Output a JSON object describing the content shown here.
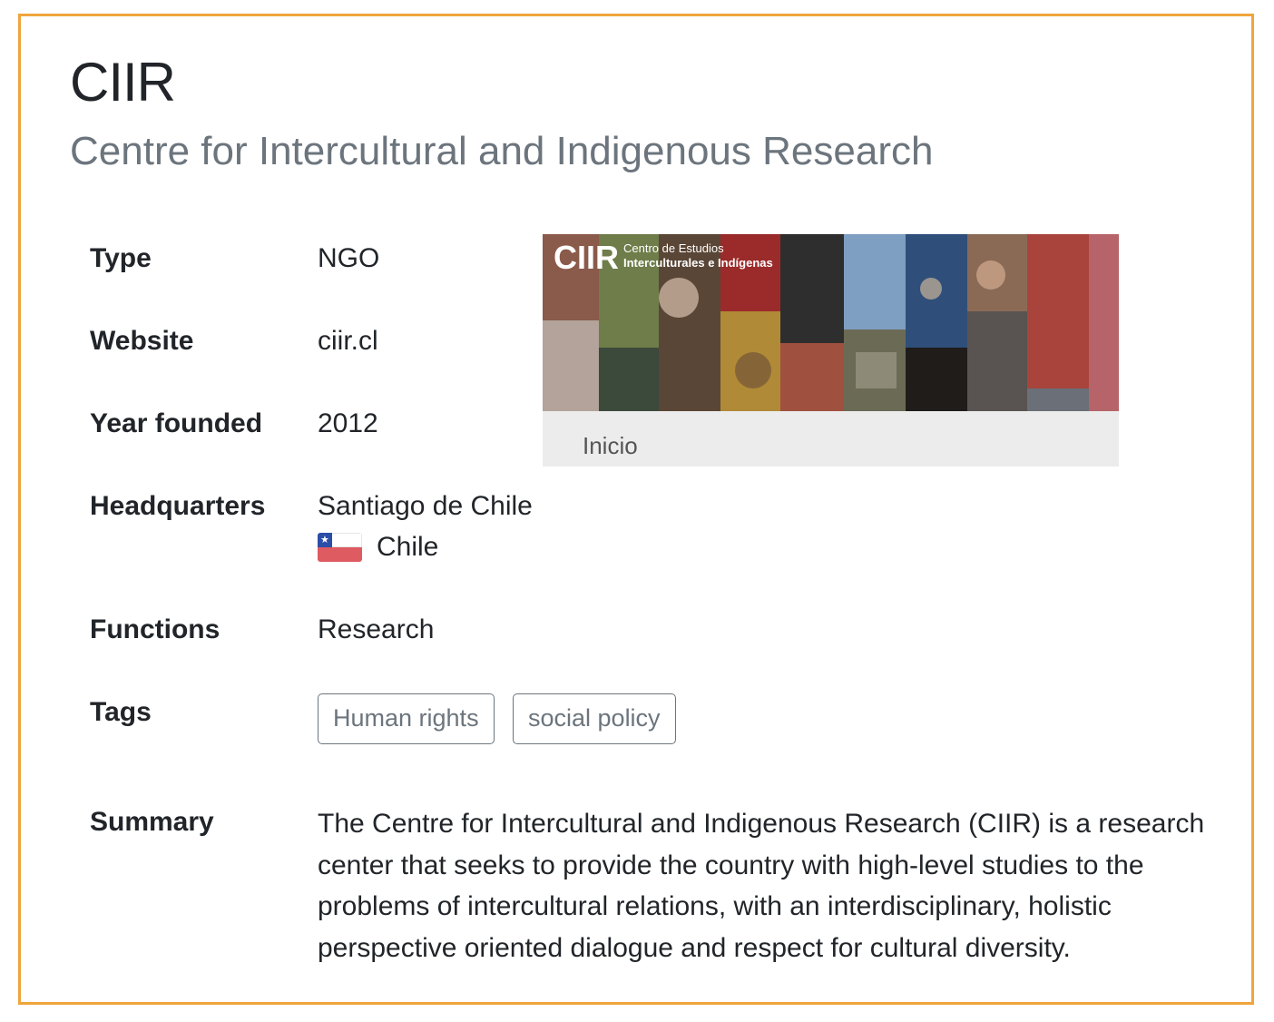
{
  "org": {
    "acronym": "CIIR",
    "full_name": "Centre for Intercultural and Indigenous Research"
  },
  "details": {
    "type": {
      "label": "Type",
      "value": "NGO"
    },
    "website": {
      "label": "Website",
      "value": "ciir.cl"
    },
    "year_founded": {
      "label": "Year founded",
      "value": "2012"
    },
    "headquarters": {
      "label": "Headquarters",
      "city": "Santiago de Chile",
      "country": "Chile",
      "flag_icon": "chile-flag-icon"
    },
    "functions": {
      "label": "Functions",
      "value": "Research"
    },
    "tags": {
      "label": "Tags",
      "items": [
        "Human rights",
        "social policy"
      ]
    },
    "summary": {
      "label": "Summary",
      "text": "The Centre for Intercultural and Indigenous Research (CIIR) is a research center that seeks to provide the country with high-level studies to the problems of intercultural relations, with an interdisciplinary, holistic perspective oriented dialogue and respect for cultural diversity."
    }
  },
  "banner": {
    "logo_text": "CIIR",
    "tagline_line1": "Centro de Estudios",
    "tagline_line2": "Interculturales e Indígenas",
    "caption": "Inicio"
  },
  "colors": {
    "card_border": "#efa53c",
    "subtitle": "#6c757d",
    "tag_border": "#6c757d",
    "flag_red": "#de5b62",
    "flag_blue": "#2b4ea8"
  }
}
